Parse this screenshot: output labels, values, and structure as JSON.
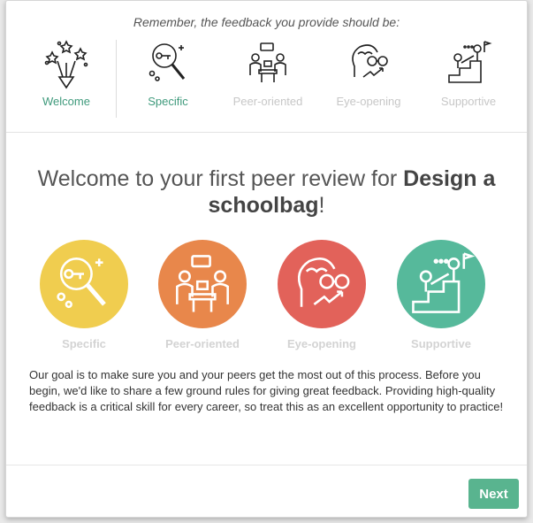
{
  "dialog": {
    "reminder": "Remember, the feedback you provide should be:",
    "steps": [
      {
        "label": "Welcome",
        "icon": "fireworks-icon",
        "state": "active"
      },
      {
        "label": "Specific",
        "icon": "magnifier-key-icon",
        "state": "active"
      },
      {
        "label": "Peer-oriented",
        "icon": "people-table-icon",
        "state": "inactive"
      },
      {
        "label": "Eye-opening",
        "icon": "head-eyeglasses-icon",
        "state": "inactive"
      },
      {
        "label": "Supportive",
        "icon": "climbing-stairs-icon",
        "state": "inactive"
      }
    ],
    "title": {
      "prefix": "Welcome to your first peer review for ",
      "course": "Design a schoolbag",
      "suffix": "!"
    },
    "principles": [
      {
        "label": "Specific",
        "color": "#f0cd4f",
        "icon": "magnifier-key-icon"
      },
      {
        "label": "Peer-oriented",
        "color": "#e8874b",
        "icon": "people-table-icon"
      },
      {
        "label": "Eye-opening",
        "color": "#e2625a",
        "icon": "head-eyeglasses-icon"
      },
      {
        "label": "Supportive",
        "color": "#56b99b",
        "icon": "climbing-stairs-icon"
      }
    ],
    "body": "Our goal is to make sure you and your peers get the most out of this process. Before you begin, we'd like to share a few ground rules for giving great feedback. Providing high-quality feedback is a critical skill for every career, so treat this as an excellent opportunity to practice!",
    "next_label": "Next"
  },
  "colors": {
    "accent": "#59b48f",
    "active_step": "#3f9a7c",
    "inactive_step": "#c7c7c7"
  }
}
